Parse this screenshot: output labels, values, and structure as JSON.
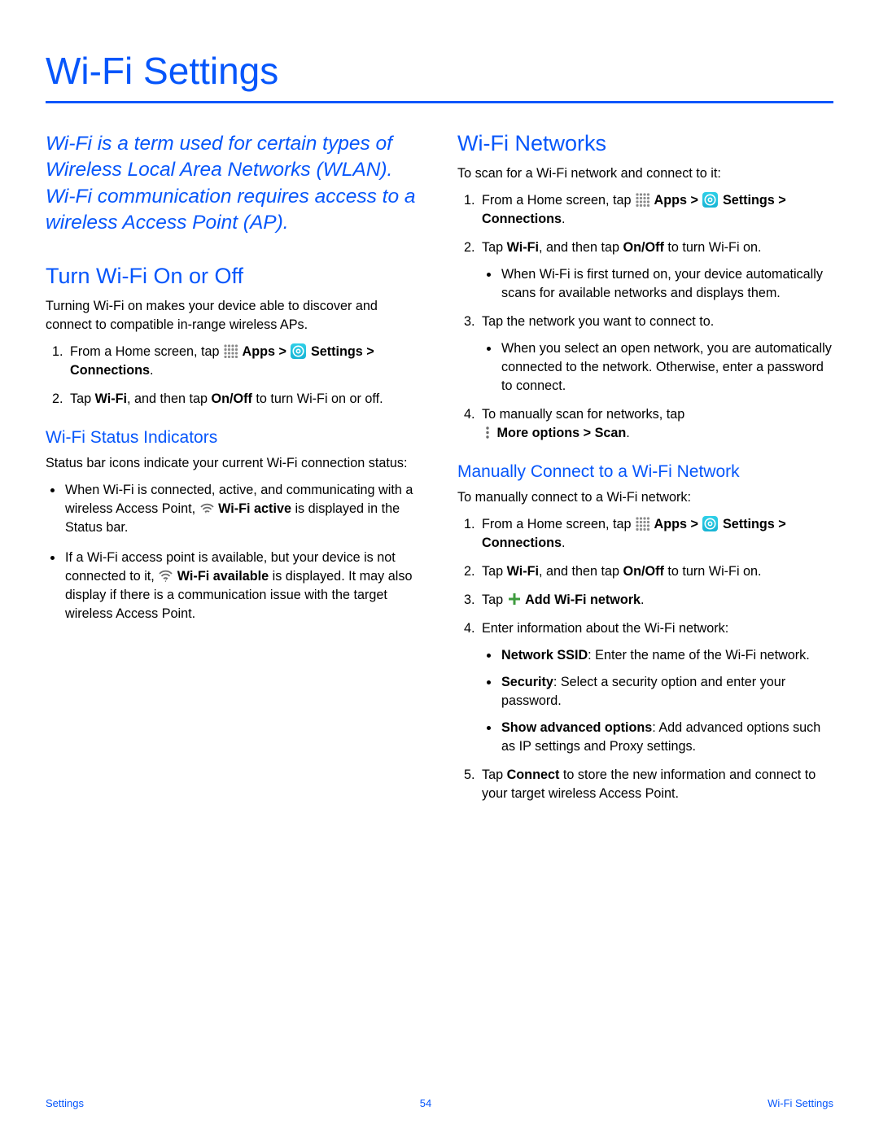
{
  "page_title": "Wi-Fi Settings",
  "intro": "Wi-Fi is a term used for certain types of Wireless Local Area Networks (WLAN). Wi-Fi communication requires access to a wireless Access Point (AP).",
  "left": {
    "h2": "Turn Wi-Fi On or Off",
    "p1": "Turning Wi-Fi on makes your device able to discover and connect to compatible in-range wireless APs.",
    "step1_a": "From a Home screen, tap ",
    "apps_label": "Apps",
    "settings_label": "Settings",
    "connections_label": "Connections",
    "step2_a": "Tap ",
    "wifi_bold": "Wi-Fi",
    "step2_b": ", and then tap ",
    "onoff_bold": "On/Off",
    "step2_c": " to turn Wi-Fi on or off.",
    "h3": "Wi-Fi Status Indicators",
    "p2": "Status bar icons indicate your current Wi-Fi connection status:",
    "b1_a": "When Wi-Fi is connected, active, and communicating with a wireless Access Point, ",
    "wifi_active": "Wi-Fi active",
    "b1_b": " is displayed in the Status bar.",
    "b2_a": "If a Wi-Fi access point is available, but your device is not connected to it, ",
    "wifi_avail": "Wi-Fi available",
    "b2_b": " is displayed. It may also display if there is a communication issue with the target wireless Access Point."
  },
  "right": {
    "h2": "Wi-Fi Networks",
    "p1": "To scan for a Wi-Fi network and connect to it:",
    "step1_a": "From a Home screen, tap ",
    "step2_c": " to turn Wi-Fi on.",
    "sub2": "When Wi-Fi is first turned on, your device automatically scans for available networks and displays them.",
    "step3": "Tap the network you want to connect to.",
    "sub3": "When you select an open network, you are automatically connected to the network. Otherwise, enter a password to connect.",
    "step4_a": "To manually scan for networks, tap ",
    "more_scan": "More options > Scan",
    "h3": "Manually Connect to a Wi-Fi Network",
    "p2": "To manually connect to a Wi-Fi network:",
    "m2_c": " to turn Wi-Fi on.",
    "m3_a": "Tap ",
    "add_wifi": "Add Wi-Fi network",
    "m4": "Enter information about the Wi-Fi network:",
    "m4b1_a": "Network SSID",
    "m4b1_b": ": Enter the name of the Wi-Fi network.",
    "m4b2_a": "Security",
    "m4b2_b": ": Select a security option and enter your password.",
    "m4b3_a": "Show advanced options",
    "m4b3_b": ": Add advanced options such as IP settings and Proxy settings.",
    "m5_a": "Tap ",
    "connect": "Connect",
    "m5_b": " to store the new information and connect to your target wireless Access Point."
  },
  "footer": {
    "left": "Settings",
    "center": "54",
    "right": "Wi-Fi Settings"
  }
}
